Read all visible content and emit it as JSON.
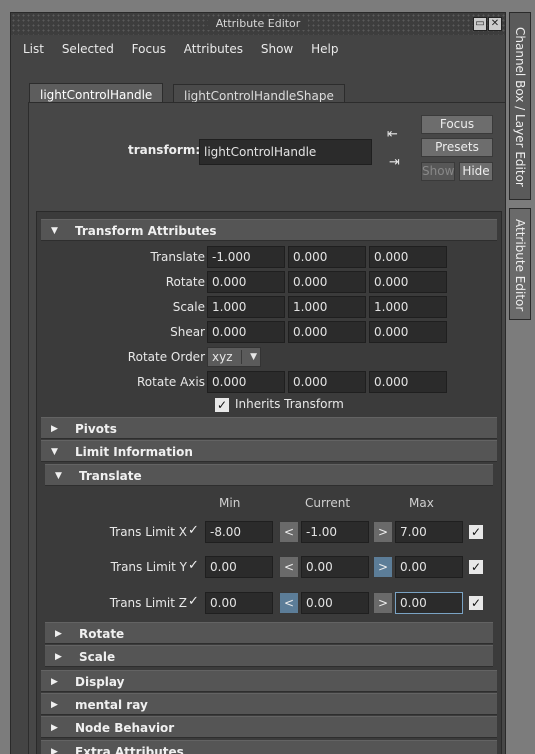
{
  "window": {
    "title": "Attribute Editor",
    "controls": [
      "▭",
      "✕"
    ]
  },
  "menu": [
    "List",
    "Selected",
    "Focus",
    "Attributes",
    "Show",
    "Help"
  ],
  "tabs": [
    {
      "label": "lightControlHandle",
      "active": true
    },
    {
      "label": "lightControlHandleShape",
      "active": false
    }
  ],
  "transform_row": {
    "label": "transform:",
    "value": "lightControlHandle"
  },
  "buttons": {
    "focus": "Focus",
    "presets": "Presets",
    "show": "Show",
    "hide": "Hide"
  },
  "sections": {
    "transform_attributes": "Transform Attributes",
    "pivots": "Pivots",
    "limit_information": "Limit Information",
    "translate": "Translate",
    "rotate": "Rotate",
    "scale": "Scale",
    "display": "Display",
    "mental_ray": "mental ray",
    "node_behavior": "Node Behavior",
    "extra_attributes": "Extra Attributes"
  },
  "attributes": {
    "translate": {
      "label": "Translate",
      "values": [
        "-1.000",
        "0.000",
        "0.000"
      ]
    },
    "rotate": {
      "label": "Rotate",
      "values": [
        "0.000",
        "0.000",
        "0.000"
      ]
    },
    "scale": {
      "label": "Scale",
      "values": [
        "1.000",
        "1.000",
        "1.000"
      ]
    },
    "shear": {
      "label": "Shear",
      "values": [
        "0.000",
        "0.000",
        "0.000"
      ]
    },
    "rotate_order": {
      "label": "Rotate Order",
      "value": "xyz"
    },
    "rotate_axis": {
      "label": "Rotate Axis",
      "values": [
        "0.000",
        "0.000",
        "0.000"
      ]
    },
    "inherits": {
      "label": "Inherits Transform",
      "checked": true
    }
  },
  "limits": {
    "columns": [
      "Min",
      "Current",
      "Max"
    ],
    "rows": [
      {
        "label": "Trans Limit X",
        "min_enabled": true,
        "min": "-8.00",
        "current": "-1.00",
        "max": "7.00",
        "max_enabled": true
      },
      {
        "label": "Trans Limit Y",
        "min_enabled": true,
        "min": "0.00",
        "current": "0.00",
        "max": "0.00",
        "max_enabled": true
      },
      {
        "label": "Trans Limit Z",
        "min_enabled": true,
        "min": "0.00",
        "current": "0.00",
        "max": "0.00",
        "max_enabled": true
      }
    ],
    "arrow_left": "<",
    "arrow_right": ">"
  },
  "side_tabs": {
    "channel_box": "Channel Box / Layer Editor",
    "attribute_editor": "Attribute Editor"
  },
  "colors": {
    "window_bg": "#444444",
    "field_bg": "#2b2b2b",
    "header_bg": "#555555",
    "highlight": "#5c7d98"
  }
}
